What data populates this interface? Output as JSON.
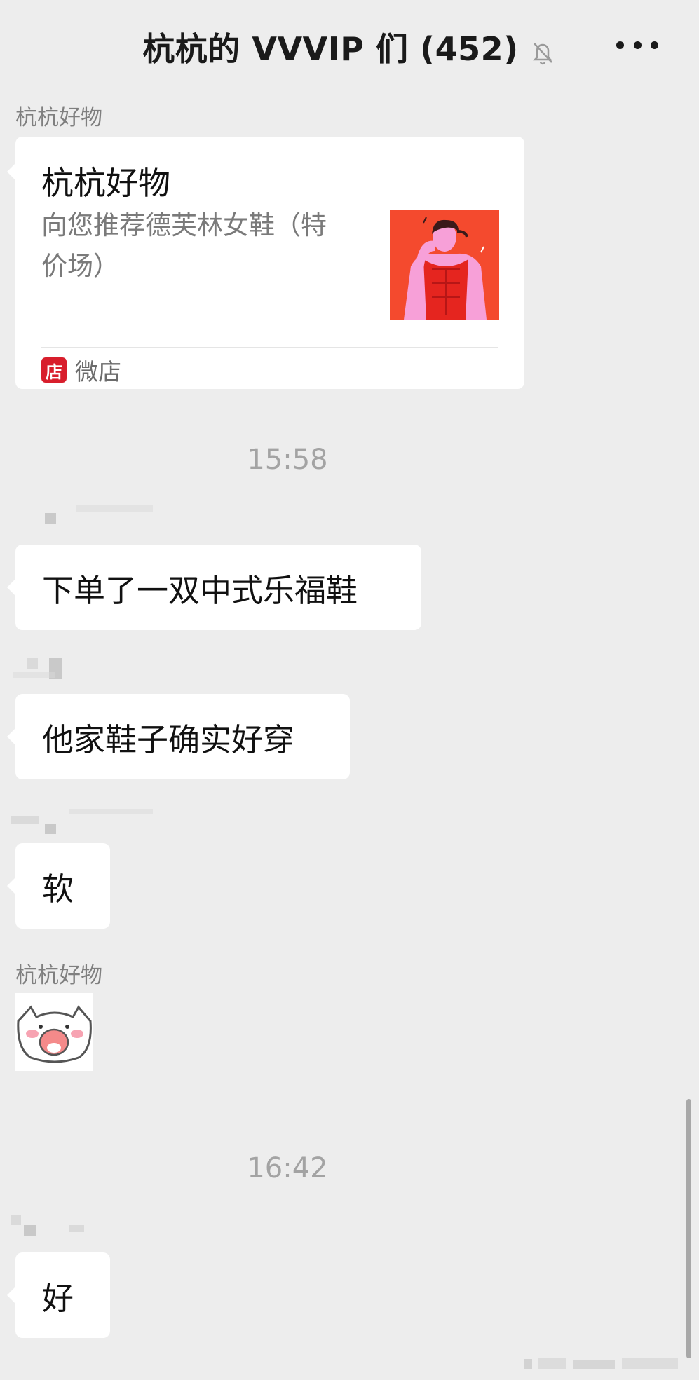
{
  "header": {
    "title": "杭杭的 VVVIP 们 (452)"
  },
  "messages": {
    "card": {
      "sender": "杭杭好物",
      "title": "杭杭好物",
      "description": "向您推荐德芙林女鞋（特价场）",
      "source_label": "微店",
      "source_icon_char": "店"
    },
    "time1": "15:58",
    "msg1": "下单了一双中式乐福鞋",
    "msg2": "他家鞋子确实好穿",
    "msg3": "软",
    "sticker_sender": "杭杭好物",
    "time2": "16:42",
    "msg4": "好"
  },
  "colors": {
    "background": "#ededed",
    "bubble": "#ffffff",
    "shop_icon": "#d81e2c",
    "thumb": "#f44a2e"
  }
}
